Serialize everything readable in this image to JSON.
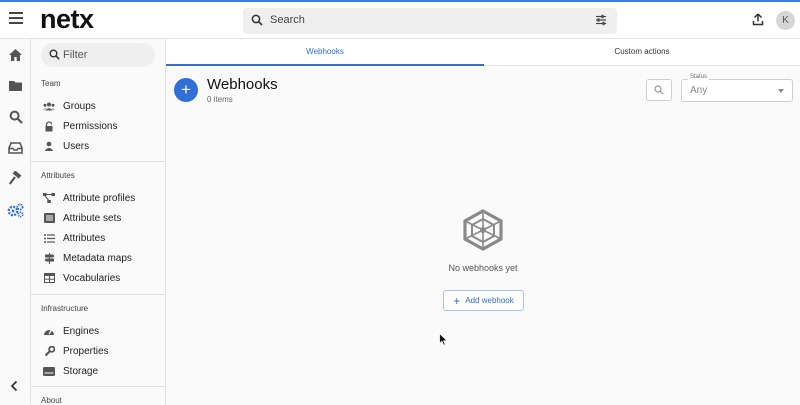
{
  "app": {
    "logo": "netx"
  },
  "header": {
    "search_placeholder": "Search",
    "avatar_initial": "K"
  },
  "rail": {
    "icons": [
      "home-icon",
      "folder-icon",
      "search-icon",
      "inbox-icon",
      "hammer-icon",
      "gears-icon"
    ],
    "active": "gears-icon"
  },
  "sidebar": {
    "filter_placeholder": "Filter",
    "sections": [
      {
        "label": "Team",
        "items": [
          "Groups",
          "Permissions",
          "Users"
        ]
      },
      {
        "label": "Attributes",
        "items": [
          "Attribute profiles",
          "Attribute sets",
          "Attributes",
          "Metadata maps",
          "Vocabularies"
        ]
      },
      {
        "label": "Infrastructure",
        "items": [
          "Engines",
          "Properties",
          "Storage"
        ]
      },
      {
        "label": "About",
        "items": []
      }
    ]
  },
  "tabs": [
    {
      "label": "Webhooks",
      "active": true
    },
    {
      "label": "Custom actions",
      "active": false
    }
  ],
  "main": {
    "title": "Webhooks",
    "count": "0 items",
    "status_label": "Status",
    "status_value": "Any",
    "empty_text": "No webhooks yet",
    "add_label": "Add webhook"
  },
  "colors": {
    "accent": "#2f6fd6",
    "topline": "#3b7ddd"
  }
}
